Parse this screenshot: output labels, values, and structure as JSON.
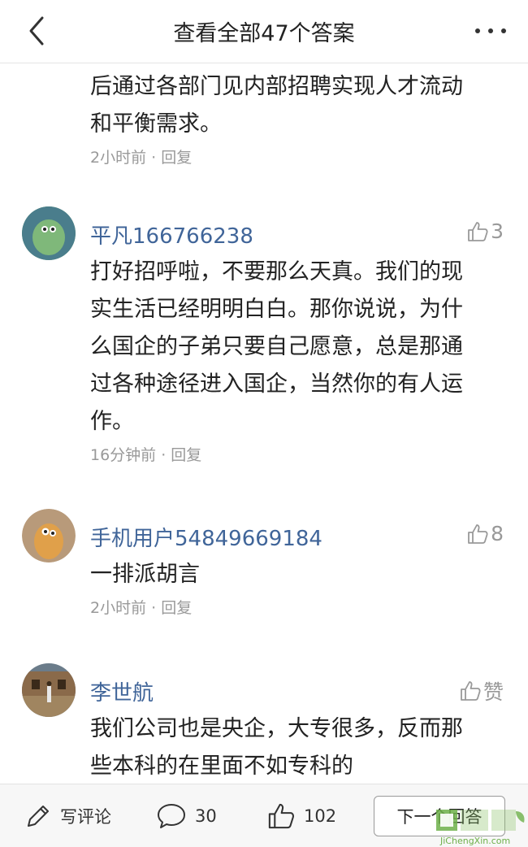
{
  "header": {
    "title": "查看全部47个答案",
    "back_icon": "chevron-left-icon",
    "more_icon": "more-dots-icon"
  },
  "partial_comment": {
    "text_line1": "后通过各部门见内部招聘实现人才流动",
    "text_line2": "和平衡需求。",
    "meta": "2小时前 · 回复"
  },
  "comments": [
    {
      "username": "平凡166766238",
      "likes": "3",
      "lines": [
        "打好招呼啦，不要那么天真。我们的现",
        "实生活已经明明白白。那你说说，为什",
        "么国企的子弟只要自己愿意，总是那通",
        "过各种途径进入国企，当然你的有人运",
        "作。"
      ],
      "meta": "16分钟前 · 回复",
      "avatar_color": "#5a9a6e"
    },
    {
      "username": "手机用户54849669184",
      "likes": "8",
      "lines": [
        "一排派胡言"
      ],
      "meta": "2小时前 · 回复",
      "avatar_color": "#c9a06a"
    },
    {
      "username": "李世航",
      "likes": "赞",
      "lines": [
        "我们公司也是央企，大专很多，反而那",
        "些本科的在里面不如专科的"
      ],
      "meta": "",
      "avatar_color": "#7a5a3a"
    }
  ],
  "bottom_bar": {
    "write_comment": "写评论",
    "comment_count": "30",
    "like_count": "102",
    "next_answer": "下一个回答"
  },
  "watermark": {
    "text": "JiChengXin.com"
  },
  "colors": {
    "username": "#406599",
    "meta": "#999999",
    "text": "#222222"
  }
}
